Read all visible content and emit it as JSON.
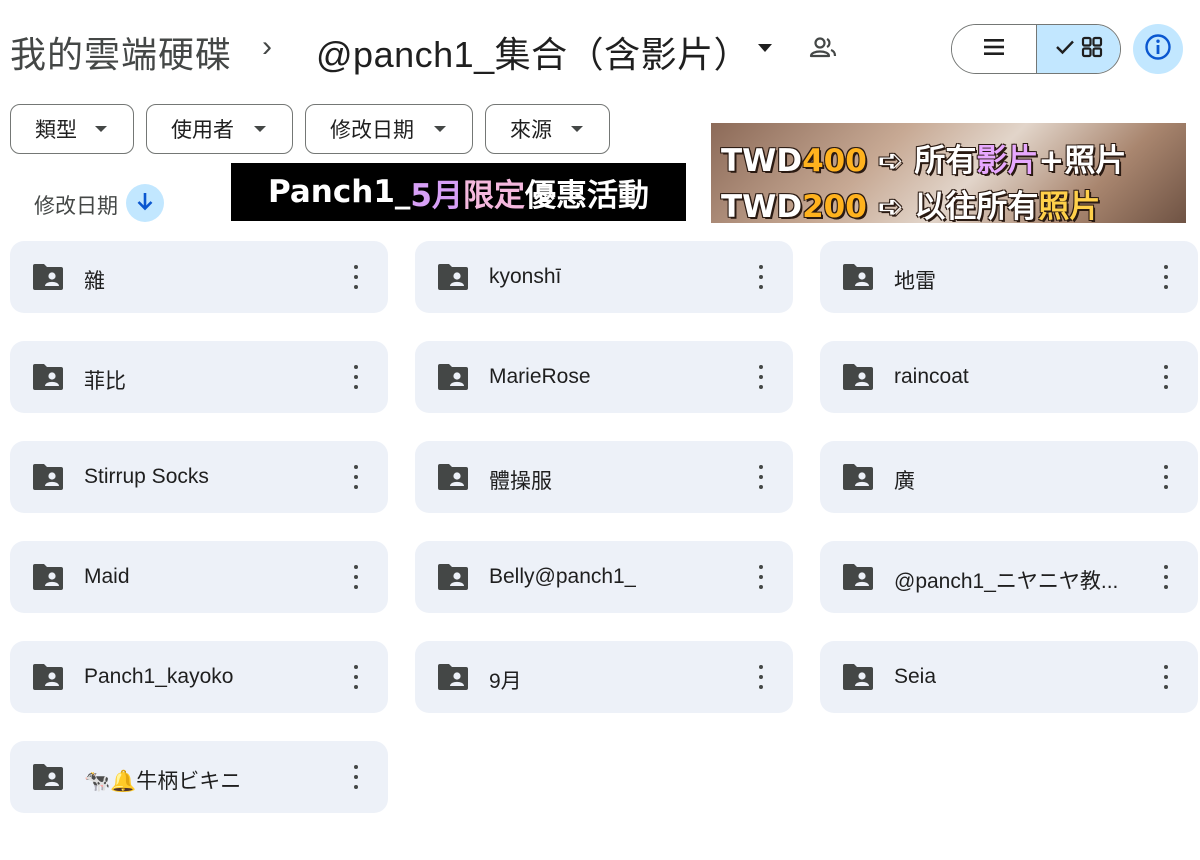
{
  "breadcrumb": {
    "root": "我的雲端硬碟",
    "separator": "›",
    "current": "@panch1_集合（含影片）"
  },
  "icons": {
    "dropdown": "arrow-drop-down-icon",
    "shared": "shared-people-icon",
    "list_view": "list-view-icon",
    "grid_view": "grid-view-icon",
    "info": "info-icon",
    "sort": "arrow-downward-icon",
    "folder": "shared-folder-icon",
    "more": "more-vertical-icon"
  },
  "filters": [
    {
      "label": "類型"
    },
    {
      "label": "使用者"
    },
    {
      "label": "修改日期"
    },
    {
      "label": "來源"
    }
  ],
  "sort": {
    "label": "修改日期"
  },
  "promo_banner": {
    "part1": "Panch1_ ",
    "part2": "5月",
    "part3": "限定",
    "part4": "優惠活動"
  },
  "price_banner": {
    "line1": {
      "prefix": "TWD",
      "amount": "400",
      "arrow": " ➪ ",
      "text1": "所有",
      "text2": "影片",
      "text3": "+照片"
    },
    "line2": {
      "prefix": "TWD",
      "amount": "200",
      "arrow": " ➪ ",
      "text1": "以往所有",
      "text2": "照片"
    }
  },
  "folders": [
    {
      "name": "雜"
    },
    {
      "name": "kyonshī"
    },
    {
      "name": "地雷"
    },
    {
      "name": "菲比"
    },
    {
      "name": "MarieRose"
    },
    {
      "name": "raincoat"
    },
    {
      "name": "Stirrup Socks"
    },
    {
      "name": "體操服"
    },
    {
      "name": "廣"
    },
    {
      "name": "Maid"
    },
    {
      "name": "Belly@panch1_"
    },
    {
      "name": "@panch1_ニヤニヤ教..."
    },
    {
      "name": "Panch1_kayoko"
    },
    {
      "name": "9月"
    },
    {
      "name": "Seia"
    },
    {
      "name": "🐄🔔牛柄ビキニ"
    }
  ],
  "colors": {
    "accent_light": "#c2e7ff",
    "card_bg": "#edf1f8",
    "icon": "#444746"
  }
}
